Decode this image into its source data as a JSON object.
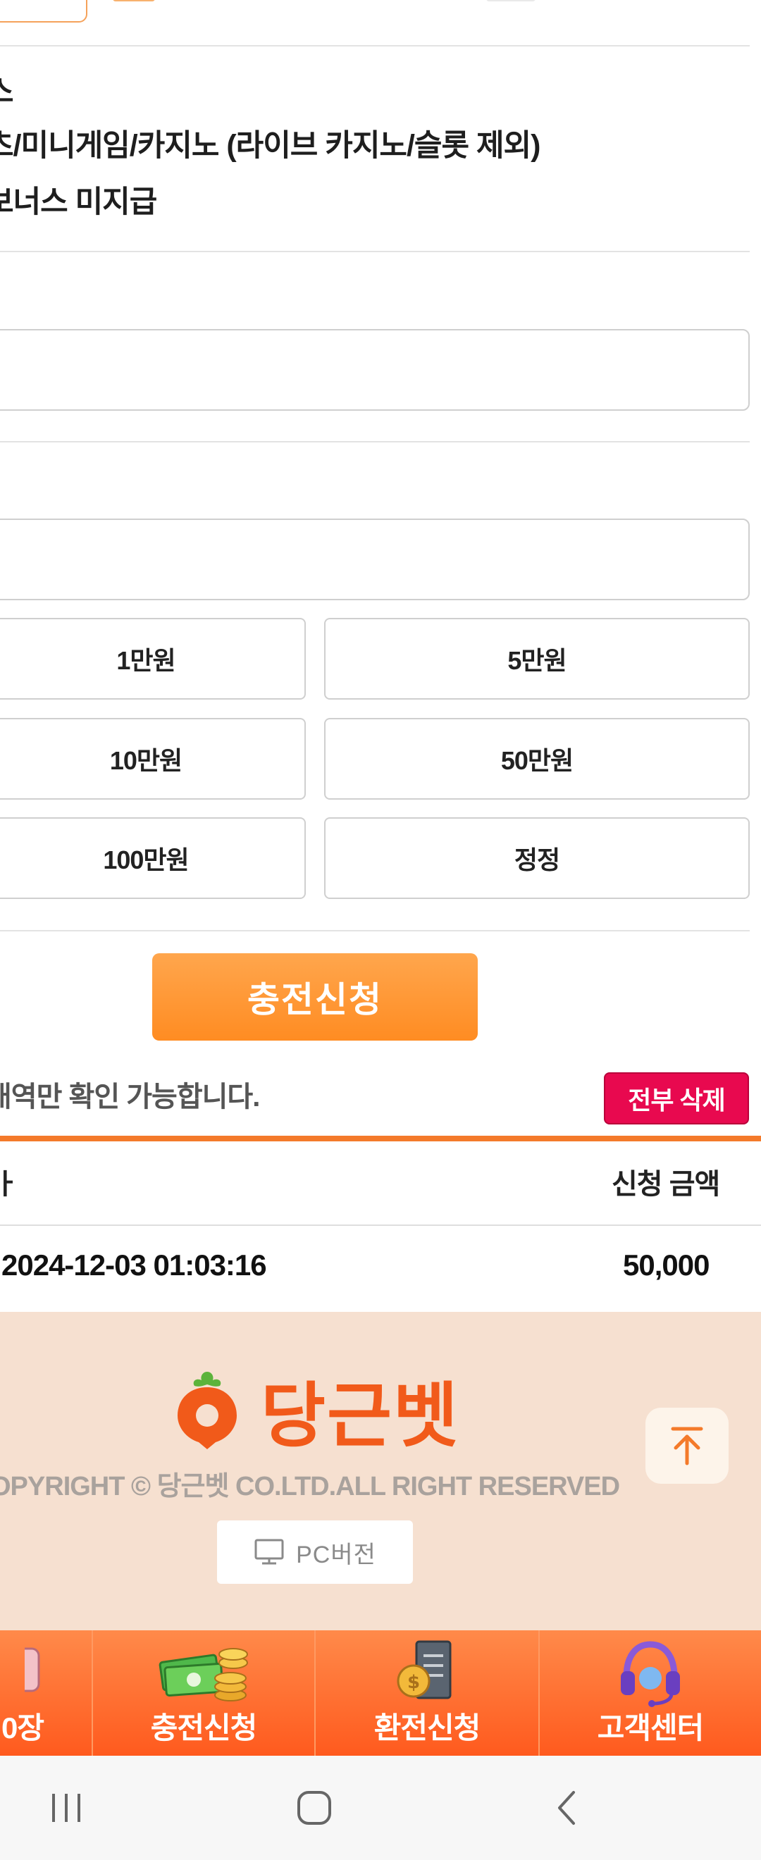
{
  "rules": {
    "line1": "스",
    "line2": "츠/미니게임/카지노 (라이브 카지노/슬롯 제외)",
    "line3": "보너스 미지급"
  },
  "amount_buttons": {
    "b1": "1만원",
    "b2": "5만원",
    "b3": "10만원",
    "b4": "50만원",
    "b5": "100만원",
    "b6": "정정"
  },
  "submit_label": "충전신청",
  "history": {
    "notice": "내역만 확인 가능합니다.",
    "delete_all_label": "전부 삭제",
    "col_date": "ㅏ",
    "col_amount": "신청 금액",
    "rows": [
      {
        "date": "2024-12-03 01:03:16",
        "amount": "50,000"
      }
    ]
  },
  "footer": {
    "logo_text": "당근벳",
    "copyright": "OPYRIGHT © 당근벳 CO.LTD.ALL RIGHT RESERVED",
    "pc_version_label": "PC버전"
  },
  "bottom_nav": {
    "item0": "0장",
    "item1": "충전신청",
    "item2": "환전신청",
    "item3": "고객센터"
  },
  "colors": {
    "accent": "#ff8c22",
    "danger": "#e8094f",
    "footer_bg": "#f6e0d0",
    "logo": "#f15a1a"
  },
  "icons": [
    "monitor-icon",
    "arrow-up-icon",
    "money-stack-icon",
    "coin-document-icon",
    "headset-icon",
    "menu-lines-icon",
    "home-square-icon",
    "back-chevron-icon"
  ]
}
